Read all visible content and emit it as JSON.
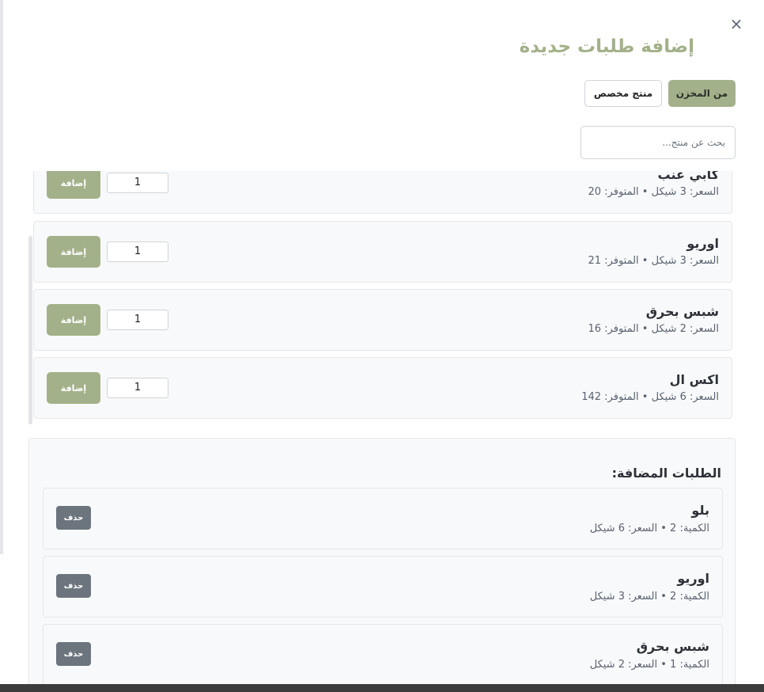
{
  "modal": {
    "close_label": "×",
    "title": "إضافة طلبات جديدة"
  },
  "tabs": {
    "from_store": "من المخزن",
    "custom_product": "منتج مخصص"
  },
  "search": {
    "placeholder": "بحث عن منتج..."
  },
  "products": [
    {
      "name": "كابي عنب",
      "meta": "السعر: 3 شيكل • المتوفر: 20",
      "qty": "1",
      "add_label": "إضافة"
    },
    {
      "name": "اوريو",
      "meta": "السعر: 3 شيكل • المتوفر: 21",
      "qty": "1",
      "add_label": "إضافة"
    },
    {
      "name": "شبس بحرق",
      "meta": "السعر: 2 شيكل • المتوفر: 16",
      "qty": "1",
      "add_label": "إضافة"
    },
    {
      "name": "اكس ال",
      "meta": "السعر: 6 شيكل • المتوفر: 142",
      "qty": "1",
      "add_label": "إضافة"
    }
  ],
  "added": {
    "title": "الطلبات المضافة:",
    "items": [
      {
        "name": "بلو",
        "meta": "الكمية: 2 • السعر: 6 شيكل",
        "delete_label": "حذف"
      },
      {
        "name": "اوريو",
        "meta": "الكمية: 2 • السعر: 3 شيكل",
        "delete_label": "حذف"
      },
      {
        "name": "شبس بحرق",
        "meta": "الكمية: 1 • السعر: 2 شيكل",
        "delete_label": "حذف"
      }
    ]
  }
}
